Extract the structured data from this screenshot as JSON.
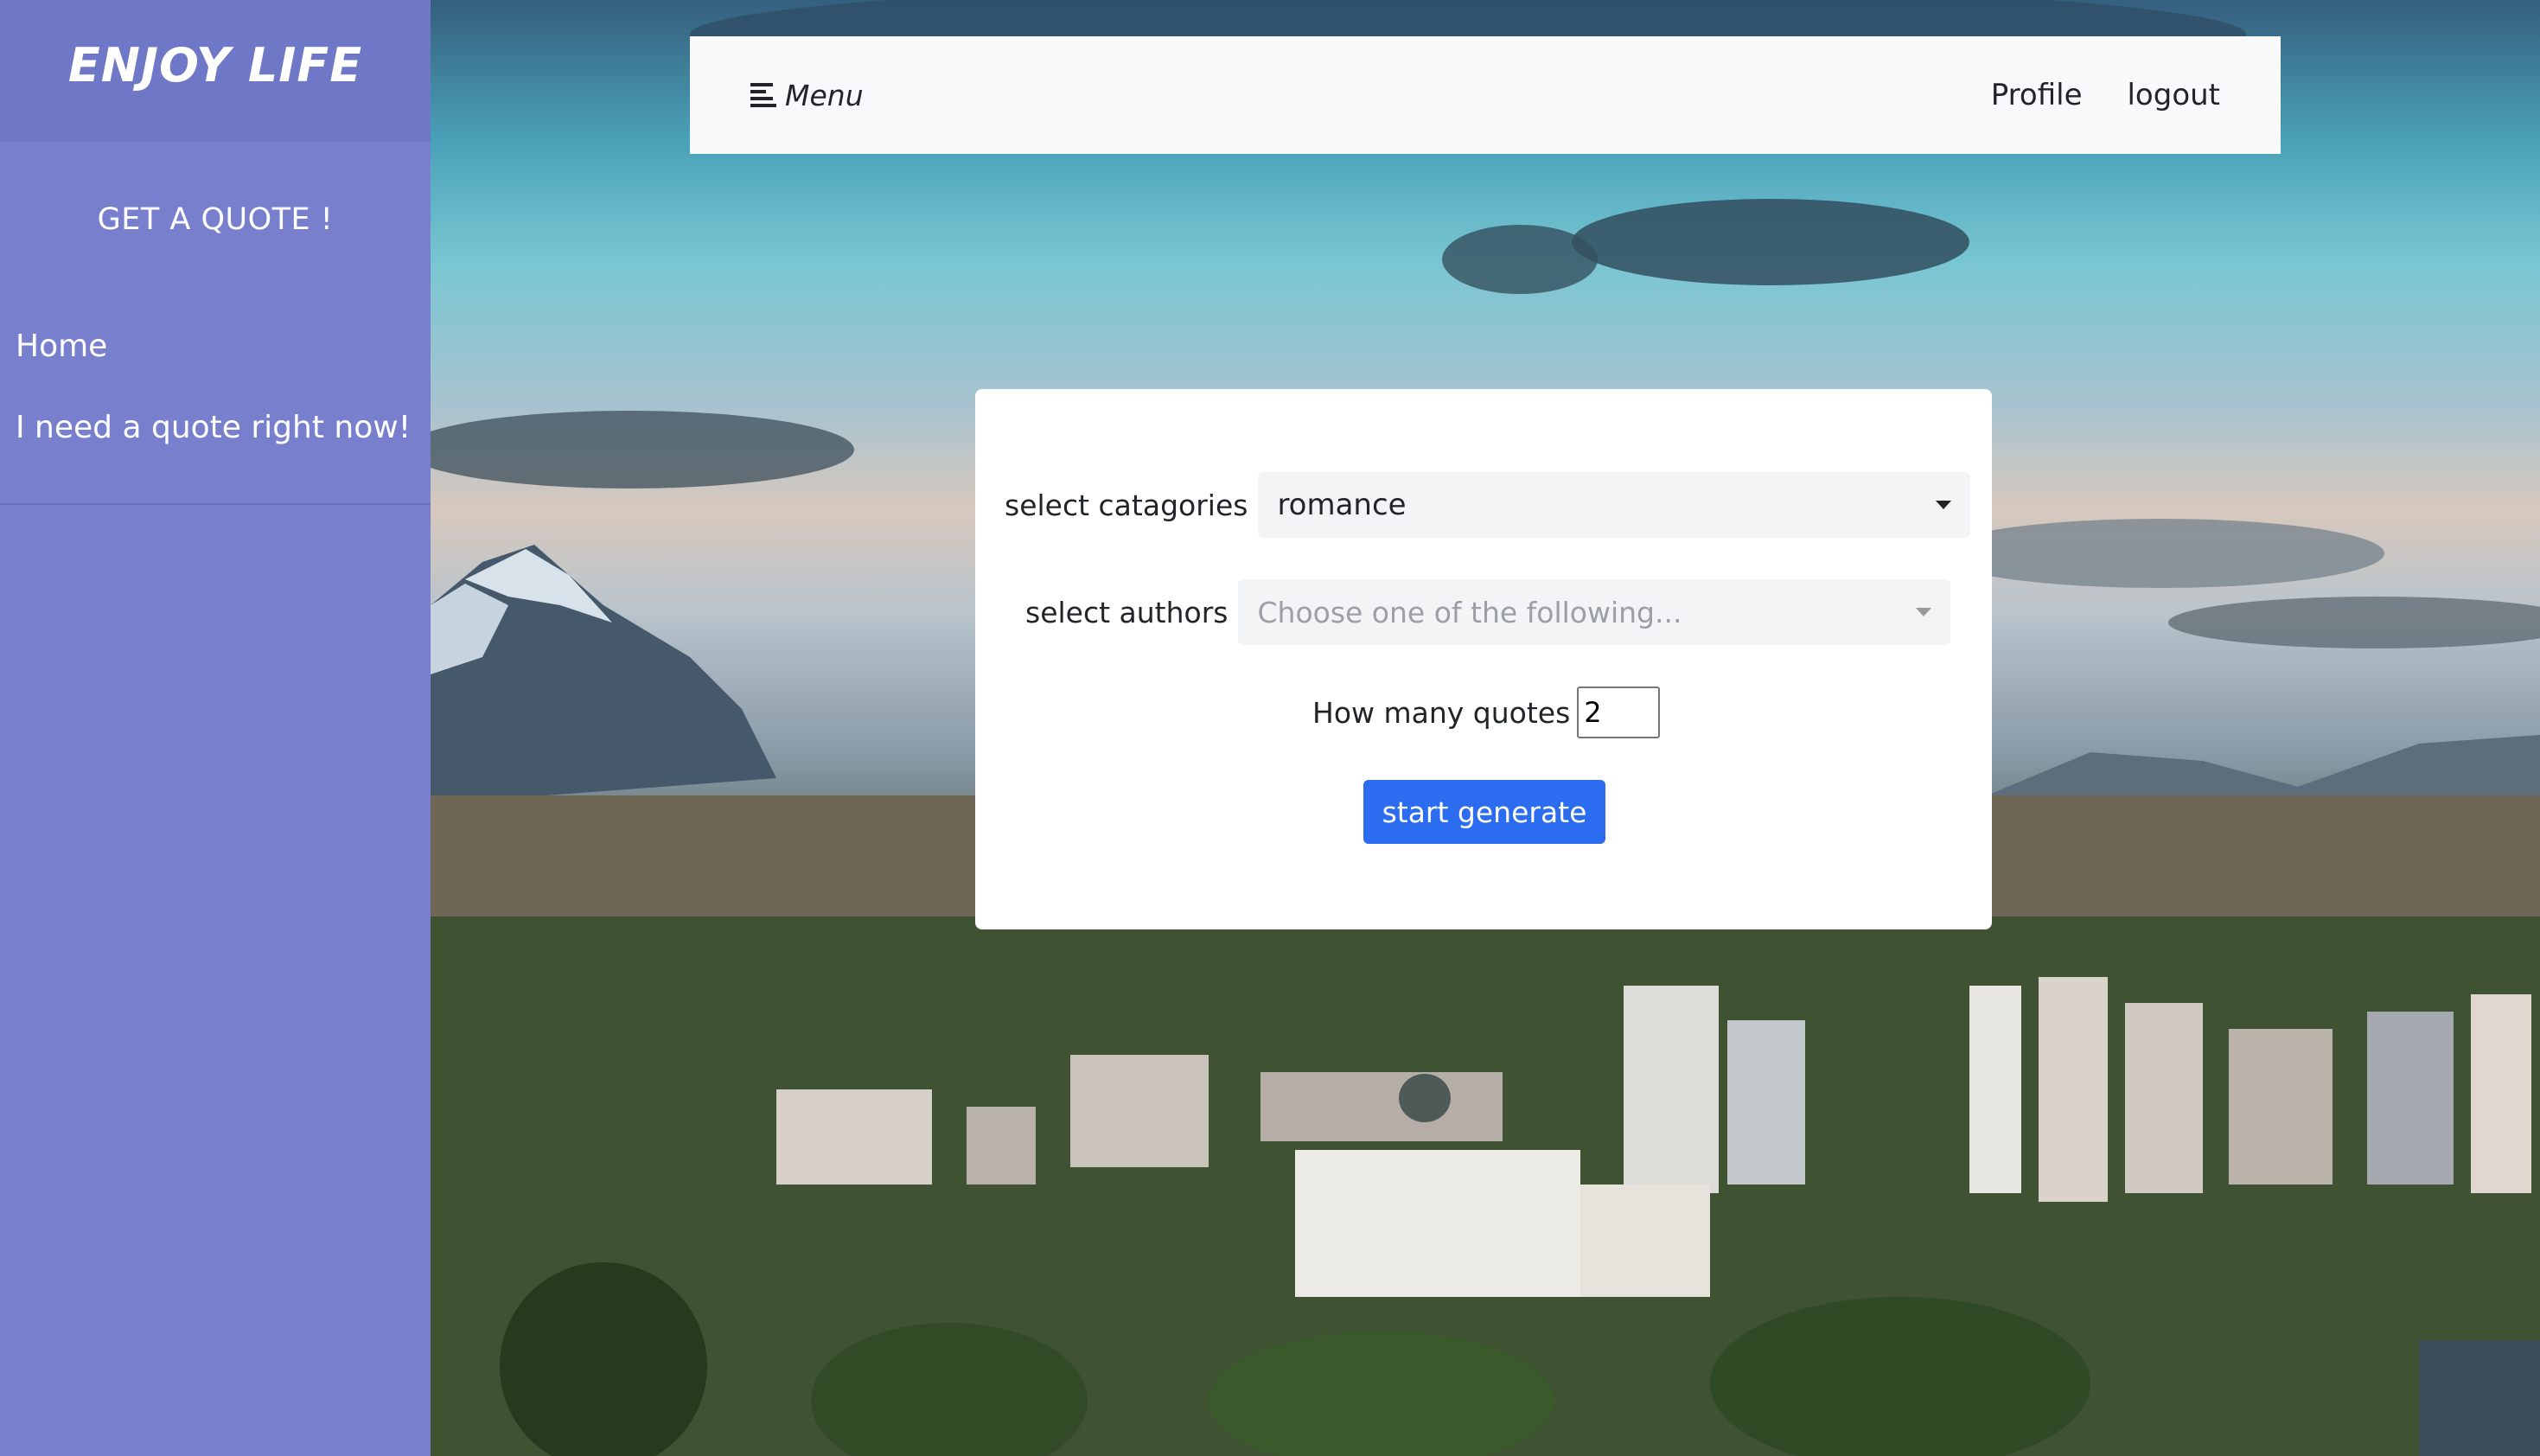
{
  "sidebar": {
    "brand": "ENJOY LIFE",
    "subtitle": "GET A QUOTE !",
    "items": [
      {
        "label": "Home"
      },
      {
        "label": "I need a quote right now!"
      }
    ],
    "bg_color": "#7880ce"
  },
  "navbar": {
    "menu_label": "Menu",
    "menu_icon": "menu-lines-icon",
    "links": [
      {
        "label": "Profile"
      },
      {
        "label": "logout"
      }
    ]
  },
  "form": {
    "categories_label": "select catagories",
    "categories_value": "romance",
    "authors_label": "select authors",
    "authors_placeholder": "Choose one of the following...",
    "count_label": "How many quotes",
    "count_value": "2",
    "submit_label": "start generate",
    "accent_color": "#2b6cf0"
  }
}
